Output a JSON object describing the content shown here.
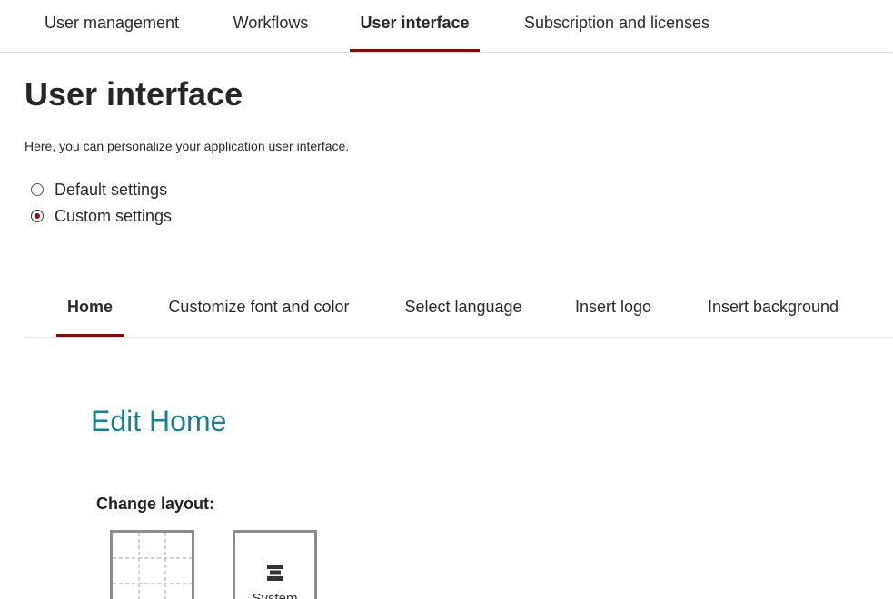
{
  "top_tabs": [
    {
      "label": "User management",
      "active": false
    },
    {
      "label": "Workflows",
      "active": false
    },
    {
      "label": "User interface",
      "active": true
    },
    {
      "label": "Subscription and licenses",
      "active": false
    }
  ],
  "page": {
    "title": "User interface",
    "description": "Here, you can personalize your application user interface."
  },
  "settings_mode": {
    "options": [
      {
        "label": "Default settings",
        "checked": false
      },
      {
        "label": "Custom settings",
        "checked": true
      }
    ]
  },
  "sub_tabs": [
    {
      "label": "Home",
      "active": true
    },
    {
      "label": "Customize font and color",
      "active": false
    },
    {
      "label": "Select language",
      "active": false
    },
    {
      "label": "Insert logo",
      "active": false
    },
    {
      "label": "Insert background",
      "active": false
    }
  ],
  "edit_section": {
    "title": "Edit Home",
    "change_layout_label": "Change layout:",
    "layout_options": [
      {
        "icon": "grid-layout-icon",
        "label": ""
      },
      {
        "icon": "system-layout-icon",
        "label": "System"
      }
    ]
  },
  "colors": {
    "accent": "#7a0f0f",
    "section_title": "#1a7f8e"
  }
}
